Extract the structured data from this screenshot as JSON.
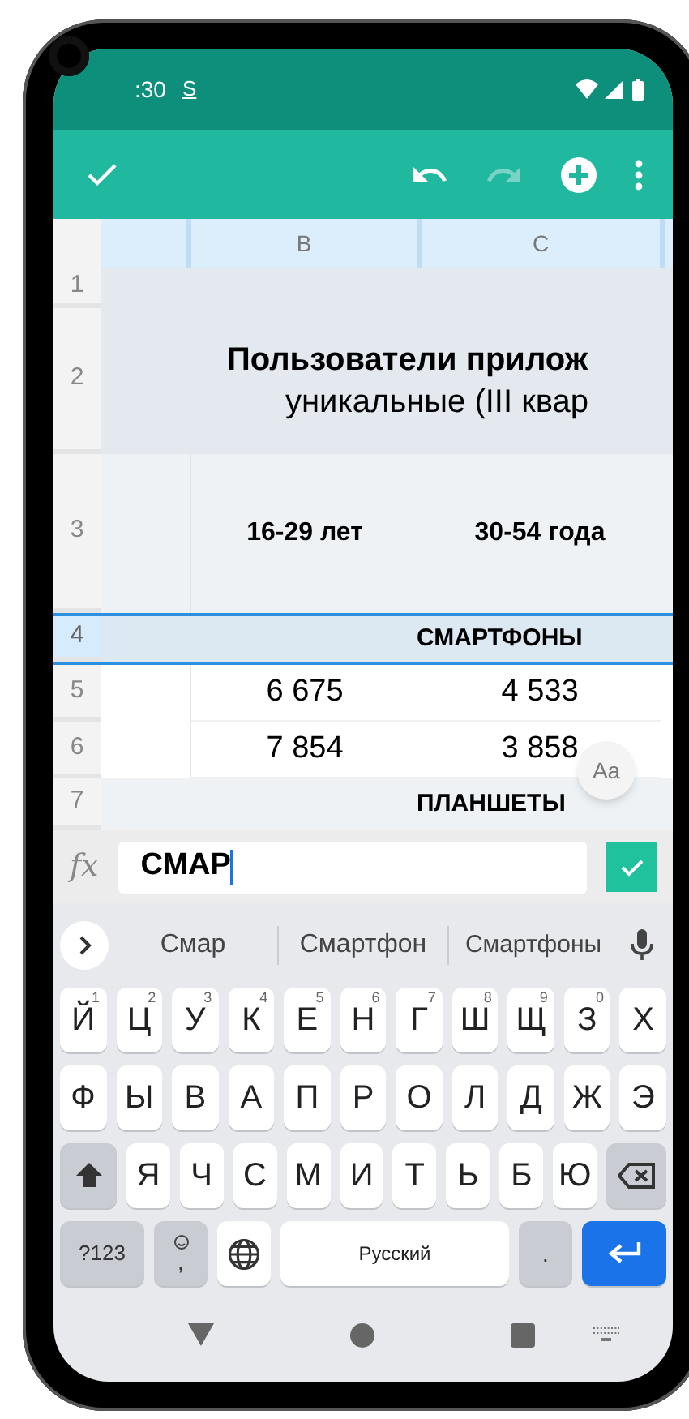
{
  "status_bar": {
    "time": ":30",
    "sim_icon": "S"
  },
  "toolbar": {
    "actions": [
      {
        "kind": "confirm",
        "disabled": false
      },
      {
        "kind": "undo",
        "disabled": false
      },
      {
        "kind": "redo",
        "disabled": true
      },
      {
        "kind": "add",
        "disabled": false
      },
      {
        "kind": "more",
        "disabled": false
      }
    ]
  },
  "sheet": {
    "columns": [
      "B",
      "C"
    ],
    "rows": [
      {
        "number": "1",
        "kind": "blank",
        "selected": false,
        "cells": []
      },
      {
        "number": "2",
        "kind": "title",
        "selected": false,
        "cells": [
          "Пользователи прилож",
          "уникальные (III квар"
        ]
      },
      {
        "number": "3",
        "kind": "header",
        "selected": false,
        "cells": [
          "16-29 лет",
          "30-54 года"
        ]
      },
      {
        "number": "4",
        "kind": "section",
        "selected": true,
        "cells": [
          "СМАРТФОНЫ"
        ]
      },
      {
        "number": "5",
        "kind": "data",
        "selected": false,
        "cells": [
          "6 675",
          "4 533"
        ]
      },
      {
        "number": "6",
        "kind": "data",
        "selected": false,
        "cells": [
          "7 854",
          "3 858"
        ]
      },
      {
        "number": "7",
        "kind": "section",
        "selected": false,
        "cells": [
          "ПЛАНШЕТЫ"
        ]
      }
    ]
  },
  "format_button": "Aa",
  "formula_bar": {
    "label": "fx",
    "value": "СМАР"
  },
  "suggestions": [
    "Смар",
    "Смартфон",
    "Смартфоны"
  ],
  "keyboard": {
    "rows": [
      {
        "keys": [
          {
            "label": "Й",
            "hint": "1"
          },
          {
            "label": "Ц",
            "hint": "2"
          },
          {
            "label": "У",
            "hint": "3"
          },
          {
            "label": "К",
            "hint": "4"
          },
          {
            "label": "Е",
            "hint": "5"
          },
          {
            "label": "Н",
            "hint": "6"
          },
          {
            "label": "Г",
            "hint": "7"
          },
          {
            "label": "Ш",
            "hint": "8"
          },
          {
            "label": "Щ",
            "hint": "9"
          },
          {
            "label": "З",
            "hint": "0"
          },
          {
            "label": "Х"
          }
        ]
      },
      {
        "keys": [
          {
            "label": "Ф"
          },
          {
            "label": "Ы"
          },
          {
            "label": "В"
          },
          {
            "label": "А"
          },
          {
            "label": "П"
          },
          {
            "label": "Р"
          },
          {
            "label": "О"
          },
          {
            "label": "Л"
          },
          {
            "label": "Д"
          },
          {
            "label": "Ж"
          },
          {
            "label": "Э"
          }
        ]
      },
      {
        "keys": [
          {
            "kind": "shift"
          },
          {
            "label": "Я"
          },
          {
            "label": "Ч"
          },
          {
            "label": "С"
          },
          {
            "label": "М"
          },
          {
            "label": "И"
          },
          {
            "label": "Т"
          },
          {
            "label": "Ь"
          },
          {
            "label": "Б"
          },
          {
            "label": "Ю"
          },
          {
            "kind": "backspace"
          }
        ]
      },
      {
        "keys": [
          {
            "kind": "symbols",
            "label": "?123"
          },
          {
            "kind": "emoji",
            "label": ","
          },
          {
            "kind": "globe"
          },
          {
            "kind": "space",
            "label": "Русский"
          },
          {
            "kind": "period",
            "label": "."
          },
          {
            "kind": "enter"
          }
        ]
      }
    ]
  }
}
